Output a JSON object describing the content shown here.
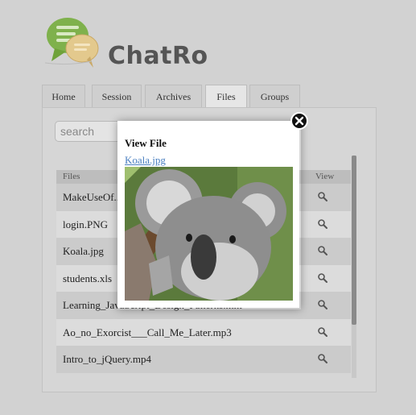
{
  "app": {
    "name": "ChatRo"
  },
  "tabs": [
    {
      "label": "Home"
    },
    {
      "label": "Session"
    },
    {
      "label": "Archives"
    },
    {
      "label": "Files",
      "active": true
    },
    {
      "label": "Groups"
    }
  ],
  "search": {
    "placeholder": "search"
  },
  "table": {
    "headers": {
      "files": "Files",
      "view": "View"
    },
    "rows": [
      {
        "name": "MakeUseOf..."
      },
      {
        "name": "login.PNG"
      },
      {
        "name": "Koala.jpg"
      },
      {
        "name": "students.xls"
      },
      {
        "name": "Learning_JavaScript_Design_Patterns.mht"
      },
      {
        "name": "Ao_no_Exorcist___Call_Me_Later.mp3"
      },
      {
        "name": "Intro_to_jQuery.mp4"
      }
    ]
  },
  "modal": {
    "title": "View File",
    "file_link": "Koala.jpg",
    "image_label": "koala photo"
  },
  "colors": {
    "link": "#4a7fc0",
    "accent_green": "#6fa23a"
  }
}
